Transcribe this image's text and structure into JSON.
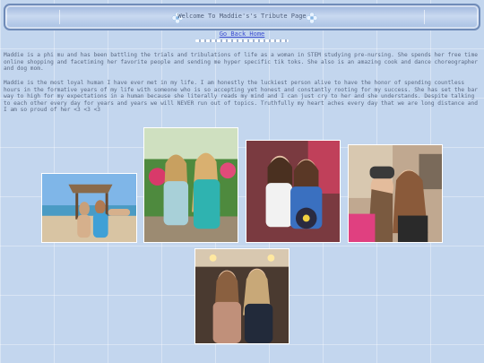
{
  "header": {
    "title": "Welcome To Maddie's's Tribute Page",
    "left_icon": "flower-icon",
    "right_icon": "flower-icon"
  },
  "nav": {
    "go_back": "Go Back Home"
  },
  "bio": {
    "paragraph1": "Maddie is a phi mu and has been battling the trials and tribulations of life as a woman in STEM studying pre-nursing. She spends her free time online shopping and facetiming her favorite people and sending me hyper specific tik toks. She also is an amazing cook and dance choreographer and dog mom.",
    "paragraph2": "Maddie is the most loyal human I have ever met in my life. I am honestly the luckiest person alive to have the honor of spending countless hours in the formative years of my life with someone who is so accepting yet honest and constantly rooting for my success. She has set the bar way to high for my expectations in a human because she literally reads my mind and I can just cry to her and she understands. Despite talking to each other every day for years and years we will NEVER run out of topics. Truthfully my heart aches every day that we are long distance and I am so proud of her <3 <3 <3"
  },
  "gallery": {
    "photos": [
      {
        "name": "beach-photo"
      },
      {
        "name": "garden-photo"
      },
      {
        "name": "childhood-photo"
      },
      {
        "name": "selfie-photo"
      },
      {
        "name": "restaurant-photo"
      }
    ]
  },
  "colors": {
    "background": "#c3d6ee",
    "banner_border": "#6f8bb8",
    "link": "#3d4fd0",
    "text": "#5b6a84"
  }
}
